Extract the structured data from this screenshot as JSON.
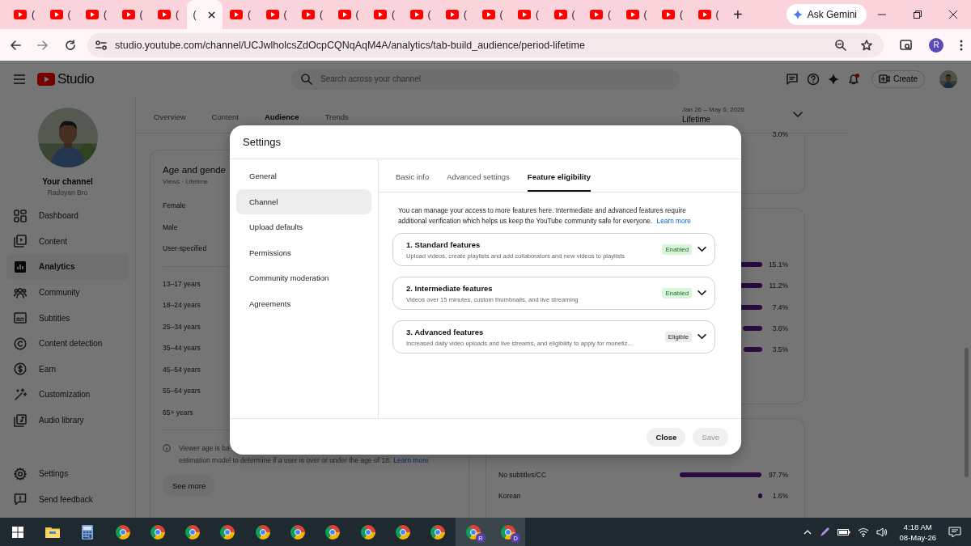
{
  "browser": {
    "tabs": [
      {
        "title": "(",
        "selected": false
      },
      {
        "title": "(",
        "selected": false
      },
      {
        "title": "(",
        "selected": false
      },
      {
        "title": "(",
        "selected": false
      },
      {
        "title": "(",
        "selected": false
      },
      {
        "title": "(",
        "selected": true
      },
      {
        "title": "(",
        "selected": false
      },
      {
        "title": "(",
        "selected": false
      },
      {
        "title": "(",
        "selected": false
      },
      {
        "title": "(",
        "selected": false
      },
      {
        "title": "(",
        "selected": false
      },
      {
        "title": "(",
        "selected": false
      },
      {
        "title": "(",
        "selected": false
      },
      {
        "title": "(",
        "selected": false
      },
      {
        "title": "(",
        "selected": false
      },
      {
        "title": "(",
        "selected": false
      },
      {
        "title": "(",
        "selected": false
      },
      {
        "title": "(",
        "selected": false
      },
      {
        "title": "(",
        "selected": false
      },
      {
        "title": "(",
        "selected": false
      }
    ],
    "new_tab": "+",
    "gemini_button": "Ask Gemini",
    "url": "studio.youtube.com/channel/UCJwlholcsZdOcpCQNqAqM4A/analytics/tab-build_audience/period-lifetime",
    "profile": "R"
  },
  "studio": {
    "logo": "Studio",
    "search_placeholder": "Search across your channel",
    "create_button": "Create",
    "channel": {
      "title": "Your channel",
      "name": "Radoyan Bro"
    },
    "nav": [
      {
        "kind": "dashboard",
        "label": "Dashboard",
        "selected": false
      },
      {
        "kind": "content",
        "label": "Content",
        "selected": false
      },
      {
        "kind": "analytics",
        "label": "Analytics",
        "selected": true
      },
      {
        "kind": "community",
        "label": "Community",
        "selected": false
      },
      {
        "kind": "subtitles",
        "label": "Subtitles",
        "selected": false
      },
      {
        "kind": "copyright",
        "label": "Content detection",
        "selected": false
      },
      {
        "kind": "earn",
        "label": "Earn",
        "selected": false
      },
      {
        "kind": "customization",
        "label": "Customization",
        "selected": false
      },
      {
        "kind": "audio",
        "label": "Audio library",
        "selected": false
      }
    ],
    "nav_bottom": [
      {
        "kind": "settings",
        "label": "Settings"
      },
      {
        "kind": "feedback",
        "label": "Send feedback"
      }
    ],
    "tabs": [
      {
        "label": "Overview",
        "selected": false
      },
      {
        "label": "Content",
        "selected": false
      },
      {
        "label": "Audience",
        "selected": true
      },
      {
        "label": "Trends",
        "selected": false
      }
    ],
    "date_range": "Jan 26 – May 6, 2026",
    "period": "Lifetime",
    "age_card": {
      "title": "Age and gende",
      "subtitle": "Views · Lifetime",
      "genders": [
        "Female",
        "Male",
        "User-specified"
      ],
      "ages": [
        "13–17 years",
        "18–24 years",
        "25–34 years",
        "35–44 years",
        "45–54 years",
        "55–64 years",
        "65+ years"
      ],
      "note_lines": [
        "Viewer age is ba",
        "estimation model to determine if a user is over or under the age of 18."
      ],
      "note_link": "Learn more",
      "see_more": "See more"
    },
    "top_card": {
      "reading": "3.0%"
    },
    "bars_card": {
      "rows": [
        {
          "reading": "15.1%"
        },
        {
          "reading": "11.2%"
        },
        {
          "reading": "7.4%"
        },
        {
          "reading": "3.6%"
        },
        {
          "reading": "3.5%"
        }
      ]
    },
    "language_card": {
      "rows": [
        {
          "label": "No subtitles/CC",
          "reading": "97.7%"
        },
        {
          "label": "Korean",
          "reading": "1.6%"
        }
      ]
    }
  },
  "dialog": {
    "title": "Settings",
    "nav": [
      {
        "label": "General",
        "selected": false
      },
      {
        "label": "Channel",
        "selected": true
      },
      {
        "label": "Upload defaults",
        "selected": false
      },
      {
        "label": "Permissions",
        "selected": false
      },
      {
        "label": "Community moderation",
        "selected": false
      },
      {
        "label": "Agreements",
        "selected": false
      }
    ],
    "tabs": [
      {
        "label": "Basic info",
        "selected": false
      },
      {
        "label": "Advanced settings",
        "selected": false
      },
      {
        "label": "Feature eligibility",
        "selected": true
      }
    ],
    "description": "You can manage your access to more features here. Intermediate and advanced features require additional verification which helps us keep the YouTube community safe for everyone.",
    "learn_more": "Learn more",
    "features": [
      {
        "title": "1. Standard features",
        "description": "Upload videos, create playlists and add collaborators and new videos to playlists",
        "kind": "enabled",
        "badge": "Enabled"
      },
      {
        "title": "2. Intermediate features",
        "description": "Videos over 15 minutes, custom thumbnails, and live streaming",
        "kind": "enabled",
        "badge": "Enabled"
      },
      {
        "title": "3. Advanced features",
        "description": "Increased daily video uploads and live streams, and eligibility to apply for monetiz...",
        "kind": "eligible",
        "badge": "Eligible"
      }
    ],
    "buttons": [
      {
        "label": "Close",
        "disabled": false
      },
      {
        "label": "Save",
        "disabled": true
      }
    ]
  },
  "taskbar": {
    "apps": [
      {
        "kind": "start",
        "active": false
      },
      {
        "kind": "files",
        "active": false
      },
      {
        "kind": "calculator",
        "active": false
      },
      {
        "kind": "browser",
        "active": false
      },
      {
        "kind": "browser",
        "active": false
      },
      {
        "kind": "browser",
        "active": false
      },
      {
        "kind": "browser",
        "active": false
      },
      {
        "kind": "browser",
        "active": false
      },
      {
        "kind": "browser",
        "active": false
      },
      {
        "kind": "browser",
        "active": false
      },
      {
        "kind": "browser",
        "active": false
      },
      {
        "kind": "browser",
        "active": false
      },
      {
        "kind": "browser",
        "active": false
      },
      {
        "kind": "browser",
        "active": true,
        "badge": "R"
      },
      {
        "kind": "browser",
        "active": true,
        "badge": "D"
      }
    ],
    "time": "4:18 AM",
    "date": "08-May-26"
  }
}
